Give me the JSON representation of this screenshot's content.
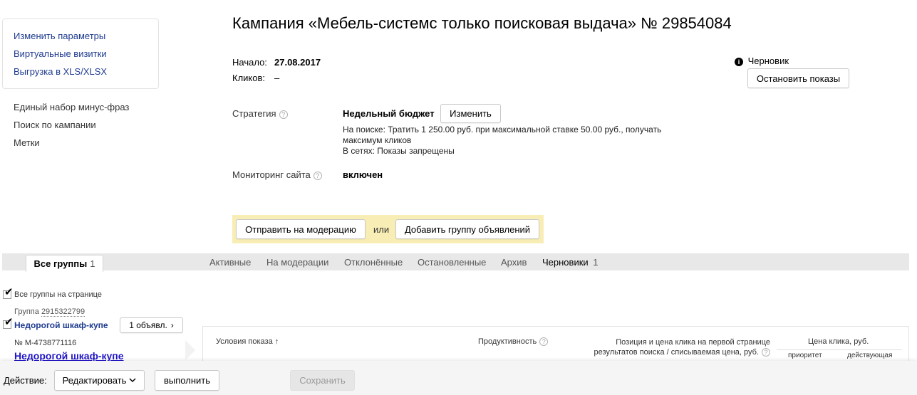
{
  "sidebar": {
    "box_links": [
      "Изменить параметры",
      "Виртуальные визитки",
      "Выгрузка в XLS/XLSX"
    ],
    "links": [
      "Единый набор минус-фраз",
      "Поиск по кампании",
      "Метки"
    ]
  },
  "campaign": {
    "title": "Кампания «Мебель-системс только поисковая выдача» № 29854084",
    "start_label": "Начало:",
    "start_value": "27.08.2017",
    "clicks_label": "Кликов:",
    "clicks_value": "–",
    "status_label": "Черновик",
    "stop_button": "Остановить показы",
    "strategy_label": "Стратегия",
    "strategy_value": "Недельный бюджет",
    "change_button": "Изменить",
    "strategy_line1": "На поиске: Тратить 1 250.00 руб. при максимальной ставке 50.00 руб., получать",
    "strategy_line2": "максимум кликов",
    "strategy_line3": "В сетях: Показы запрещены",
    "monitoring_label": "Мониторинг сайта",
    "monitoring_value": "включен",
    "moderation_button": "Отправить на модерацию",
    "or_label": "или",
    "add_group_button": "Добавить группу объявлений"
  },
  "tabs": {
    "active_label": "Все группы",
    "active_count": "1",
    "items": [
      "Активные",
      "На модерации",
      "Отклонённые",
      "Остановленные",
      "Архив"
    ],
    "drafts_label": "Черновики",
    "drafts_count": "1"
  },
  "groups": {
    "select_all_label": "Все группы на странице",
    "group_label": "Группа",
    "group_id": "2915322799",
    "group_name": "Недорогой шкаф-купе",
    "ads_button": "1 объявл.",
    "ad_number": "№ M-4738771116",
    "ad_title": "Недорогой шкаф-купе"
  },
  "table": {
    "col_conditions": "Условия показа",
    "col_productivity": "Продуктивность",
    "col_position_line1": "Позиция и цена клика на первой странице",
    "col_position_line2": "результатов поиска / списываемая цена, руб.",
    "col_price": "Цена клика, руб.",
    "col_priority": "приоритет",
    "col_effective": "действующая"
  },
  "bottom": {
    "action_label": "Действие:",
    "action_select": "Редактировать",
    "execute_button": "выполнить",
    "save_button": "Сохранить"
  },
  "icons": {
    "help": "question-circle-icon",
    "info": "info-circle-icon",
    "checkbox": "checkmark-icon",
    "sort": "sort-arrow-up-icon",
    "chevron": "chevron-right-icon",
    "dropdown": "chevron-down-icon"
  }
}
